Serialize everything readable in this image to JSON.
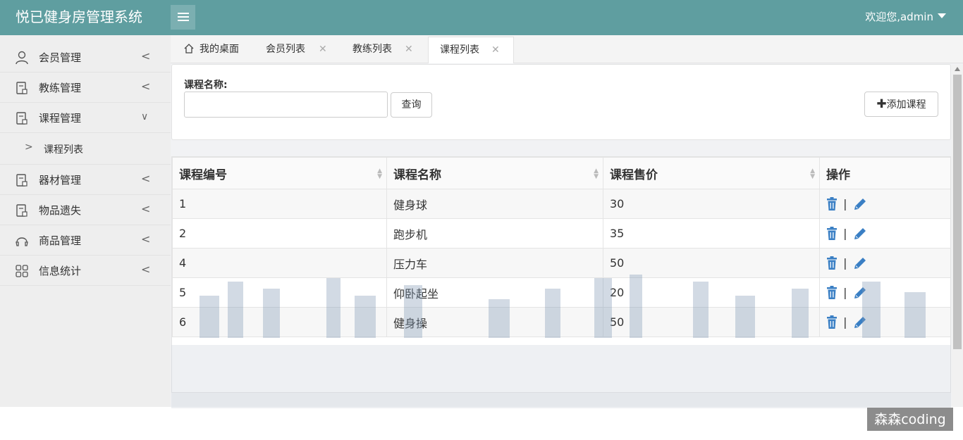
{
  "header": {
    "logo": "悦已健身房管理系统",
    "welcome": "欢迎您,admin"
  },
  "sidebar": {
    "items": [
      {
        "label": "会员管理",
        "arrow": "<"
      },
      {
        "label": "教练管理",
        "arrow": "<"
      },
      {
        "label": "课程管理",
        "arrow": "∨"
      },
      {
        "label": "课程列表",
        "arrow": ">"
      },
      {
        "label": "器材管理",
        "arrow": "<"
      },
      {
        "label": "物品遗失",
        "arrow": "<"
      },
      {
        "label": "商品管理",
        "arrow": "<"
      },
      {
        "label": "信息统计",
        "arrow": "<"
      }
    ]
  },
  "tabs": [
    {
      "label": "我的桌面"
    },
    {
      "label": "会员列表"
    },
    {
      "label": "教练列表"
    },
    {
      "label": "课程列表"
    }
  ],
  "filter": {
    "label": "课程名称:",
    "input_value": "",
    "search_button": "查询",
    "add_button": "添加课程"
  },
  "table": {
    "headers": [
      "课程编号",
      "课程名称",
      "课程售价",
      "操作"
    ],
    "rows": [
      {
        "id": "1",
        "name": "健身球",
        "price": "30"
      },
      {
        "id": "2",
        "name": "跑步机",
        "price": "35"
      },
      {
        "id": "4",
        "name": "压力车",
        "price": "50"
      },
      {
        "id": "5",
        "name": "仰卧起坐",
        "price": "20"
      },
      {
        "id": "6",
        "name": "健身操",
        "price": "50"
      }
    ],
    "separator": "|"
  },
  "watermark": "森森coding",
  "colors": {
    "header": "#5f9ea0",
    "icon_blue": "#3a7fc4"
  },
  "icons": {
    "home": "home-icon",
    "delete": "trash-icon",
    "edit": "pencil-icon",
    "add": "plus-icon"
  }
}
